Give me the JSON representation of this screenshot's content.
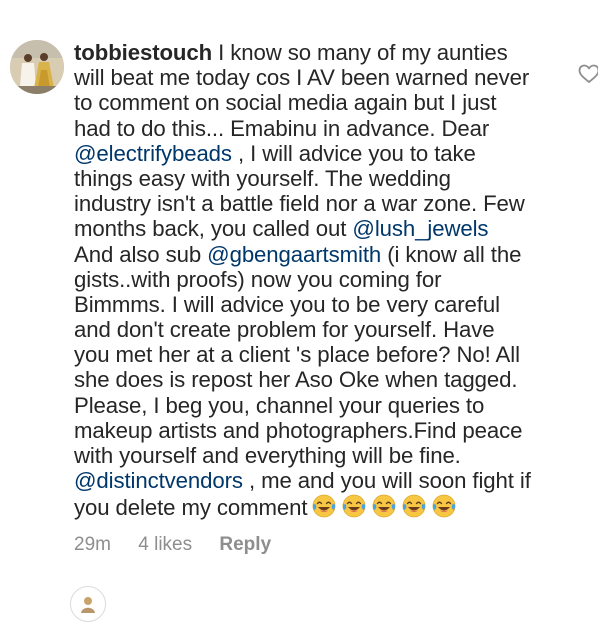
{
  "comment": {
    "username": "tobbiestouch",
    "lines": [
      [
        {
          "t": "I know so many of my aunties",
          "k": "text"
        }
      ],
      [
        {
          "t": "will beat me today cos I AV been  warned never",
          "k": "text"
        }
      ],
      [
        {
          "t": "to comment on social media again but I just",
          "k": "text"
        }
      ],
      [
        {
          "t": "had to do this... Emabinu in advance.  Dear",
          "k": "text"
        }
      ],
      [
        {
          "t": "@electrifybeads",
          "k": "mention"
        },
        {
          "t": " , I will advice  you to take",
          "k": "text"
        }
      ],
      [
        {
          "t": "things easy with yourself.  The wedding",
          "k": "text"
        }
      ],
      [
        {
          "t": "industry  isn't a battle field nor a war zone. Few",
          "k": "text"
        }
      ],
      [
        {
          "t": "months  back,  you called out ",
          "k": "text"
        },
        {
          "t": "@lush_jewels",
          "k": "mention"
        }
      ],
      [
        {
          "t": "And also sub ",
          "k": "text"
        },
        {
          "t": "@gbengaartsmith",
          "k": "mention"
        },
        {
          "t": " (i know all the",
          "k": "text"
        }
      ],
      [
        {
          "t": "gists..with proofs)  now you coming for",
          "k": "text"
        }
      ],
      [
        {
          "t": "Bimmms. I will advice you to be very careful",
          "k": "text"
        }
      ],
      [
        {
          "t": "and don't create problem for yourself. Have",
          "k": "text"
        }
      ],
      [
        {
          "t": "you met her at a client 's place before?  No!  All",
          "k": "text"
        }
      ],
      [
        {
          "t": "she does is repost her Aso Oke when tagged.",
          "k": "text"
        }
      ],
      [
        {
          "t": "Please,  I beg you, channel your queries to",
          "k": "text"
        }
      ],
      [
        {
          "t": "makeup artists and photographers.Find peace",
          "k": "text"
        }
      ],
      [
        {
          "t": "with yourself  and everything will be fine.",
          "k": "text"
        }
      ],
      [
        {
          "t": "@distinctvendors",
          "k": "mention"
        },
        {
          "t": " , me and you will soon fight if",
          "k": "text"
        }
      ],
      [
        {
          "t": "you delete my comment",
          "k": "text"
        }
      ]
    ],
    "emoji_count": 5,
    "emoji_icon": "face-with-tears-of-joy-icon",
    "time": "29m",
    "likes": "4 likes",
    "reply_label": "Reply"
  },
  "colors": {
    "text": "#262626",
    "mention": "#00376b",
    "meta": "#8e8e8e",
    "emoji_face": "#f7c744",
    "emoji_tears": "#4aa3df"
  },
  "icons": {
    "like": "heart-outline-icon",
    "avatar": "profile-avatar",
    "reply_avatar": "current-user-avatar"
  }
}
